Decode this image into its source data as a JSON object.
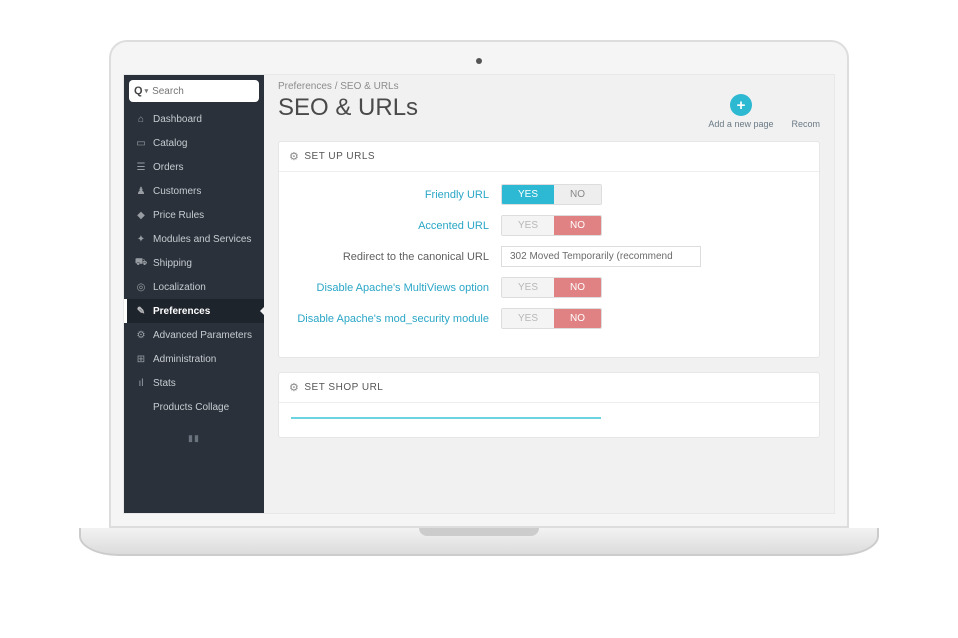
{
  "search": {
    "prefix": "Q",
    "placeholder": "Search"
  },
  "sidebar": {
    "items": [
      {
        "icon": "dashboard-icon",
        "glyph": "⌂",
        "label": "Dashboard"
      },
      {
        "icon": "catalog-icon",
        "glyph": "▭",
        "label": "Catalog"
      },
      {
        "icon": "orders-icon",
        "glyph": "☰",
        "label": "Orders"
      },
      {
        "icon": "customers-icon",
        "glyph": "♟",
        "label": "Customers"
      },
      {
        "icon": "price-rules-icon",
        "glyph": "◆",
        "label": "Price Rules"
      },
      {
        "icon": "modules-icon",
        "glyph": "✦",
        "label": "Modules and Services"
      },
      {
        "icon": "shipping-icon",
        "glyph": "⛟",
        "label": "Shipping"
      },
      {
        "icon": "localization-icon",
        "glyph": "◎",
        "label": "Localization"
      },
      {
        "icon": "preferences-icon",
        "glyph": "✎",
        "label": "Preferences",
        "active": true
      },
      {
        "icon": "advanced-icon",
        "glyph": "⚙",
        "label": "Advanced Parameters"
      },
      {
        "icon": "administration-icon",
        "glyph": "⊞",
        "label": "Administration"
      },
      {
        "icon": "stats-icon",
        "glyph": "ıl",
        "label": "Stats"
      },
      {
        "icon": "products-collage-icon",
        "glyph": "",
        "label": "Products Collage"
      }
    ]
  },
  "breadcrumb": {
    "parent": "Preferences",
    "sep": "/",
    "current": "SEO & URLs"
  },
  "page_title": "SEO & URLs",
  "actions": {
    "add": {
      "label": "Add a new page"
    },
    "recom": {
      "label": "Recom"
    }
  },
  "panel1": {
    "title": "SET UP URLS",
    "rows": {
      "friendly": {
        "label": "Friendly URL",
        "yes": "YES",
        "no": "NO",
        "value": "yes"
      },
      "accented": {
        "label": "Accented URL",
        "yes": "YES",
        "no": "NO",
        "value": "no"
      },
      "canonical": {
        "label": "Redirect to the canonical URL",
        "selected": "302 Moved Temporarily (recommend"
      },
      "multiviews": {
        "label": "Disable Apache's MultiViews option",
        "yes": "YES",
        "no": "NO",
        "value": "no"
      },
      "modsec": {
        "label": "Disable Apache's mod_security module",
        "yes": "YES",
        "no": "NO",
        "value": "no"
      }
    }
  },
  "panel2": {
    "title": "SET SHOP URL"
  }
}
